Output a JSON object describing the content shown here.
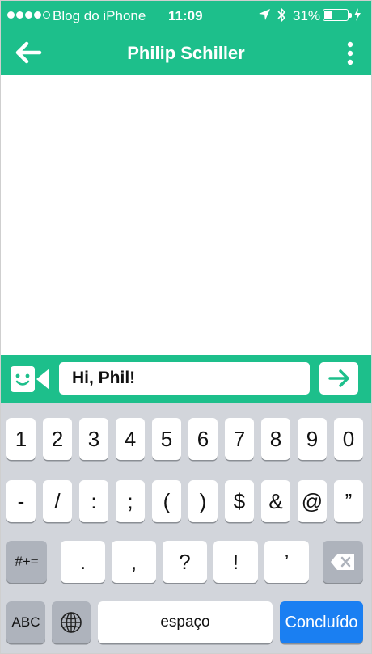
{
  "status_bar": {
    "carrier": "Blog do iPhone",
    "time": "11:09",
    "battery": "31%",
    "battery_level": 0.31,
    "signal_bars": 4
  },
  "nav": {
    "title": "Philip Schiller",
    "back_icon": "arrow-left-icon",
    "menu_icon": "vertical-dots-icon"
  },
  "composer": {
    "value": "Hi, Phil!",
    "emoji_icon": "smiley-video-icon",
    "send_icon": "arrow-right-icon"
  },
  "keyboard": {
    "row1": [
      "1",
      "2",
      "3",
      "4",
      "5",
      "6",
      "7",
      "8",
      "9",
      "0"
    ],
    "row2": [
      "-",
      "/",
      ":",
      ";",
      "(",
      ")",
      "$",
      "&",
      "@",
      "”"
    ],
    "row3_toggle": "#+=",
    "row3": [
      ".",
      ",",
      "?",
      "!",
      "’"
    ],
    "abc": "ABC",
    "space": "espaço",
    "done": "Concluído"
  },
  "colors": {
    "accent": "#1dbf8b",
    "keyboard_bg": "#d2d5db",
    "done_key": "#1a7ff2"
  }
}
